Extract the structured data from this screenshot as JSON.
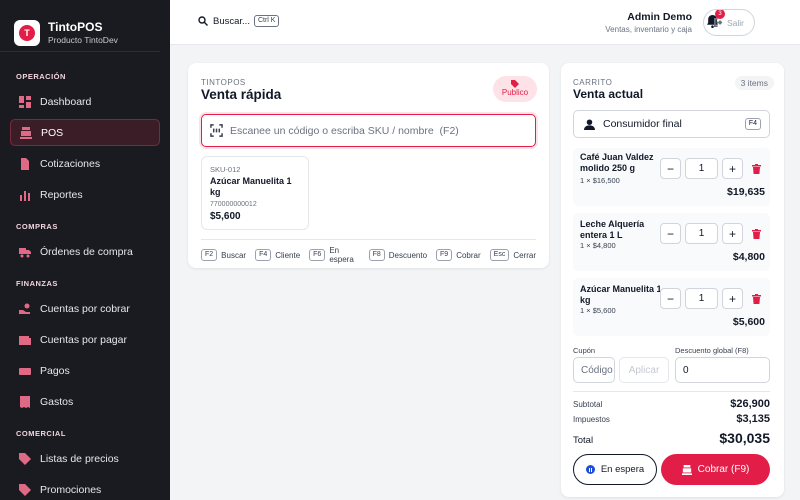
{
  "brand": {
    "title": "TintoPOS",
    "subtitle": "Producto TintoDev",
    "logo_letter": "T"
  },
  "sidebar": {
    "sections": [
      {
        "label": "OPERACIÓN",
        "items": [
          {
            "label": "Dashboard",
            "icon": "dashboard-icon"
          },
          {
            "label": "POS",
            "icon": "register-icon",
            "active": true
          },
          {
            "label": "Cotizaciones",
            "icon": "document-icon"
          },
          {
            "label": "Reportes",
            "icon": "bar-chart-icon"
          }
        ]
      },
      {
        "label": "COMPRAS",
        "items": [
          {
            "label": "Órdenes de compra",
            "icon": "truck-icon"
          }
        ]
      },
      {
        "label": "FINANZAS",
        "items": [
          {
            "label": "Cuentas por cobrar",
            "icon": "hand-coin-icon"
          },
          {
            "label": "Cuentas por pagar",
            "icon": "wallet-icon"
          },
          {
            "label": "Pagos",
            "icon": "cash-icon"
          },
          {
            "label": "Gastos",
            "icon": "receipt-icon"
          }
        ]
      },
      {
        "label": "COMERCIAL",
        "items": [
          {
            "label": "Listas de precios",
            "icon": "tag-icon"
          },
          {
            "label": "Promociones",
            "icon": "tag-icon"
          }
        ]
      }
    ]
  },
  "topbar": {
    "search_label": "Buscar...",
    "search_kbd": "Ctrl K",
    "user_name": "Admin Demo",
    "user_sub": "Ventas, inventario y caja",
    "notifications": "3",
    "logout_label": "Salir"
  },
  "sale": {
    "eyebrow": "TINTOPOS",
    "title": "Venta rápida",
    "price_badge": "Publico",
    "scan_placeholder": "Escanee un código o escriba SKU / nombre  (F2)",
    "product": {
      "sku": "SKU-012",
      "name": "Azúcar Manuelita 1 kg",
      "barcode": "770000000012",
      "price": "$5,600"
    },
    "shortcuts": [
      {
        "key": "F2",
        "label": "Buscar"
      },
      {
        "key": "F4",
        "label": "Cliente"
      },
      {
        "key": "F6",
        "label": "En espera"
      },
      {
        "key": "F8",
        "label": "Descuento"
      },
      {
        "key": "F9",
        "label": "Cobrar"
      },
      {
        "key": "Esc",
        "label": "Cerrar"
      }
    ]
  },
  "cart": {
    "eyebrow": "CARRITO",
    "title": "Venta actual",
    "count": "3 items",
    "customer": "Consumidor final",
    "customer_key": "F4",
    "items": [
      {
        "name": "Café Juan Valdez molido 250 g",
        "qty_line": "1 × $16,500",
        "qty": "1",
        "total": "$19,635"
      },
      {
        "name": "Leche Alquería entera 1 L",
        "qty_line": "1 × $4,800",
        "qty": "1",
        "total": "$4,800"
      },
      {
        "name": "Azúcar Manuelita 1 kg",
        "qty_line": "1 × $5,600",
        "qty": "1",
        "total": "$5,600"
      }
    ],
    "coupon_label": "Cupón",
    "coupon_placeholder": "Código",
    "coupon_apply": "Aplicar",
    "discount_label": "Descuento global (F8)",
    "discount_value": "0",
    "subtotal_label": "Subtotal",
    "subtotal": "$26,900",
    "tax_label": "Impuestos",
    "tax": "$3,135",
    "total_label": "Total",
    "total": "$30,035",
    "hold_label": "En espera",
    "pay_label": "Cobrar (F9)"
  },
  "colors": {
    "accent": "#e11d48",
    "sidebar_bg": "#1a1b21"
  }
}
